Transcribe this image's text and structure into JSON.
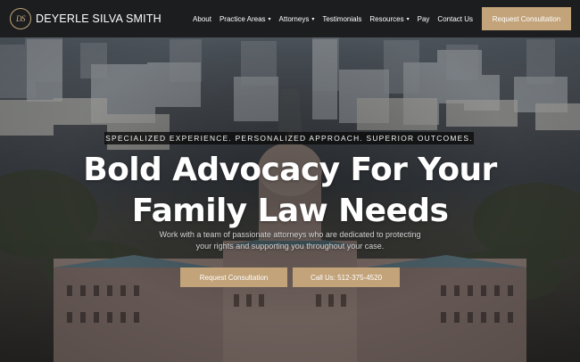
{
  "brand": {
    "logo_mark": "DS",
    "name": "DEYERLE SILVA SMITH"
  },
  "nav": {
    "items": [
      {
        "label": "About",
        "has_dropdown": false
      },
      {
        "label": "Practice Areas",
        "has_dropdown": true
      },
      {
        "label": "Attorneys",
        "has_dropdown": true
      },
      {
        "label": "Testimonials",
        "has_dropdown": false
      },
      {
        "label": "Resources",
        "has_dropdown": true
      },
      {
        "label": "Pay",
        "has_dropdown": false
      },
      {
        "label": "Contact Us",
        "has_dropdown": false
      }
    ],
    "chevron": "▾",
    "cta_label": "Request Consultation"
  },
  "hero": {
    "tagline": "SPECIALIZED EXPERIENCE. PERSONALIZED APPROACH. SUPERIOR OUTCOMES.",
    "headline_line1": "Bold Advocacy For Your",
    "headline_line2": "Family Law Needs",
    "subtext_line1": "Work with a team of passionate attorneys who are dedicated to protecting",
    "subtext_line2": "your rights and supporting you throughout your case.",
    "primary_button": "Request Consultation",
    "secondary_button": "Call Us: 512-375-4520"
  },
  "colors": {
    "header_bg": "#1c1d1f",
    "accent_gold": "#c2a37a",
    "text_white": "#ffffff"
  }
}
